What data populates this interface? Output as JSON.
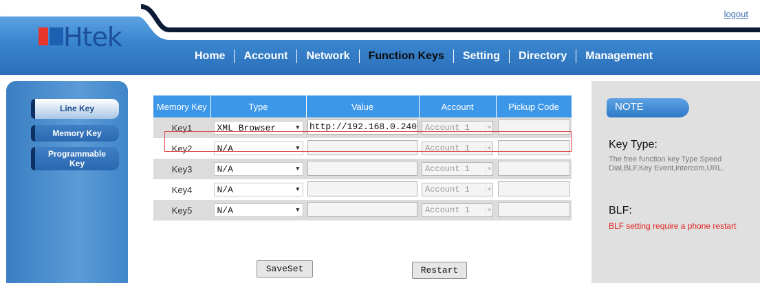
{
  "header": {
    "logo_text": "Htek",
    "logout": "logout",
    "nav": [
      {
        "label": "Home"
      },
      {
        "label": "Account"
      },
      {
        "label": "Network"
      },
      {
        "label": "Function Keys"
      },
      {
        "label": "Setting"
      },
      {
        "label": "Directory"
      },
      {
        "label": "Management"
      }
    ],
    "active_tab": "Function Keys"
  },
  "sidebar": {
    "items": [
      {
        "label": "Line Key"
      },
      {
        "label": "Memory Key"
      },
      {
        "label_line1": "Programmable",
        "label_line2": "Key"
      }
    ]
  },
  "table": {
    "headers": {
      "memory_key": "Memory Key",
      "type": "Type",
      "value": "Value",
      "account": "Account",
      "pickup_code": "Pickup Code"
    },
    "rows": [
      {
        "key": "Key1",
        "type": "XML Browser",
        "value": "http://192.168.0.240",
        "account": "Account 1",
        "pickup": ""
      },
      {
        "key": "Key2",
        "type": "N/A",
        "value": "",
        "account": "Account 1",
        "pickup": ""
      },
      {
        "key": "Key3",
        "type": "N/A",
        "value": "",
        "account": "Account 1",
        "pickup": ""
      },
      {
        "key": "Key4",
        "type": "N/A",
        "value": "",
        "account": "Account 1",
        "pickup": ""
      },
      {
        "key": "Key5",
        "type": "N/A",
        "value": "",
        "account": "Account 1",
        "pickup": ""
      }
    ]
  },
  "buttons": {
    "saveset": "SaveSet",
    "restart": "Restart"
  },
  "note": {
    "tab": "NOTE",
    "key_type_heading": "Key Type:",
    "key_type_text": "The free function key Type Speed Dial,BLF,Key Event,intercom,URL.",
    "blf_heading": "BLF:",
    "blf_text": "BLF setting require a phone restart"
  },
  "colors": {
    "header_blue": "#3a86d0",
    "table_header": "#3d97e8",
    "highlight_border": "#e04848",
    "blf_text": "#e0201e"
  }
}
